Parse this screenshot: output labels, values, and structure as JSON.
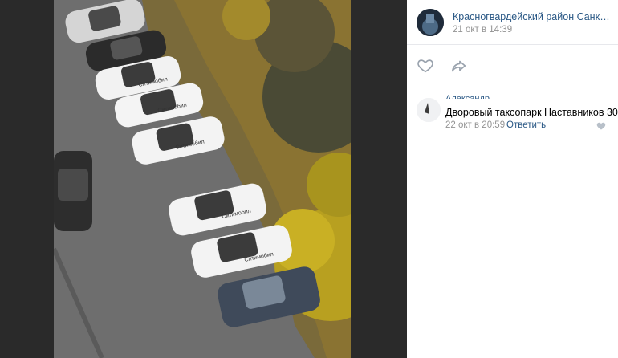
{
  "post": {
    "group_name": "Красногвардейский район Санкт - ...",
    "date": "21 окт в 14:39"
  },
  "icons": {
    "like": "heart-icon",
    "share": "share-arrow-icon",
    "comment_like": "heart-icon"
  },
  "comment": {
    "author": "Александр ...",
    "text": "Дворовый таксопарк Наставников 30",
    "date": "22 окт в 20:59",
    "reply_label": "Ответить"
  },
  "photo": {
    "car_brand_text": "Ситимобил"
  },
  "colors": {
    "link": "#2a5885",
    "muted": "#939393",
    "viewer_bg": "#2a2a2a"
  }
}
